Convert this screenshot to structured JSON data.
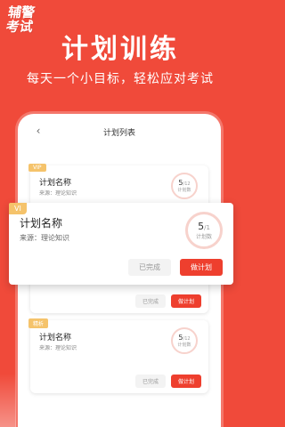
{
  "brand": {
    "line1": "辅警",
    "line2": "考试"
  },
  "hero": {
    "title": "计划训练",
    "subtitle": "每天一个小目标，轻松应对考试"
  },
  "screen": {
    "title": "计划列表"
  },
  "cards": [
    {
      "tag": "VIP",
      "title": "计划名称",
      "source": "来源：理论知识",
      "count": "5",
      "total": "/12",
      "count_label": "计划数"
    },
    {
      "tag": "",
      "title": "",
      "source": "",
      "count": "",
      "total": "",
      "count_label": "",
      "done": "已完成",
      "plan": "做计划"
    },
    {
      "tag": "精析",
      "title": "计划名称",
      "source": "来源：理论知识",
      "count": "5",
      "total": "/12",
      "count_label": "计划数",
      "done": "已完成",
      "plan": "做计划"
    }
  ],
  "featured": {
    "tag": "VI",
    "title": "计划名称",
    "source": "来源：理论知识",
    "count": "5",
    "total": "/1",
    "count_label": "计划数",
    "done": "已完成",
    "plan": "做计划"
  }
}
